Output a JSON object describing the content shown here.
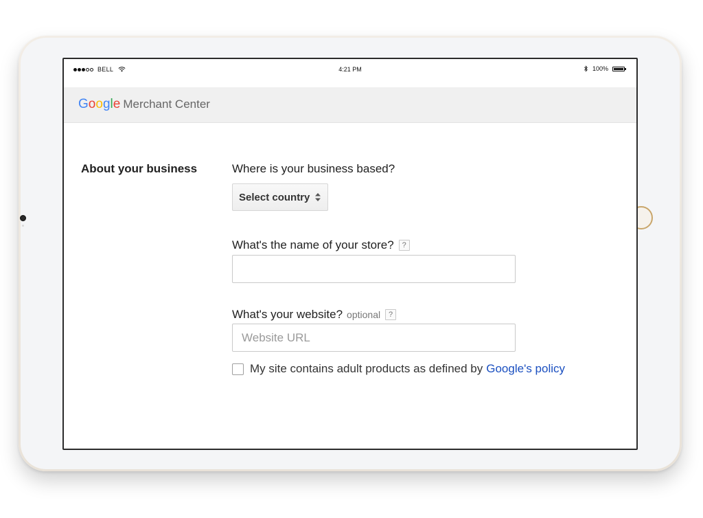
{
  "status_bar": {
    "carrier": "BELL",
    "time": "4:21 PM",
    "battery": "100%",
    "signal_bars_filled": 3,
    "signal_bars_total": 5
  },
  "header": {
    "logo_letters": [
      "G",
      "o",
      "o",
      "g",
      "l",
      "e"
    ],
    "product_name": "Merchant Center"
  },
  "section": {
    "title": "About your business"
  },
  "form": {
    "country_question": "Where is your business based?",
    "country_select_label": "Select country",
    "store_question": "What's the name of your store?",
    "store_help": "?",
    "store_value": "",
    "website_question": "What's your website?",
    "website_optional": "optional",
    "website_help": "?",
    "website_placeholder": "Website URL",
    "website_value": "",
    "adult_checkbox_checked": false,
    "adult_text": "My site contains adult products as defined by",
    "adult_link": "Google's policy"
  },
  "colors": {
    "google_blue": "#4285F4",
    "google_red": "#EA4335",
    "google_yellow": "#FBBC05",
    "google_green": "#34A853",
    "link": "#1a4fc0",
    "header_bg": "#f0f0f0"
  },
  "icons": {
    "wifi": "wifi-icon",
    "bluetooth": "bluetooth-icon",
    "battery": "battery-icon",
    "select_arrows": "select-arrows-icon",
    "help": "help-icon"
  }
}
